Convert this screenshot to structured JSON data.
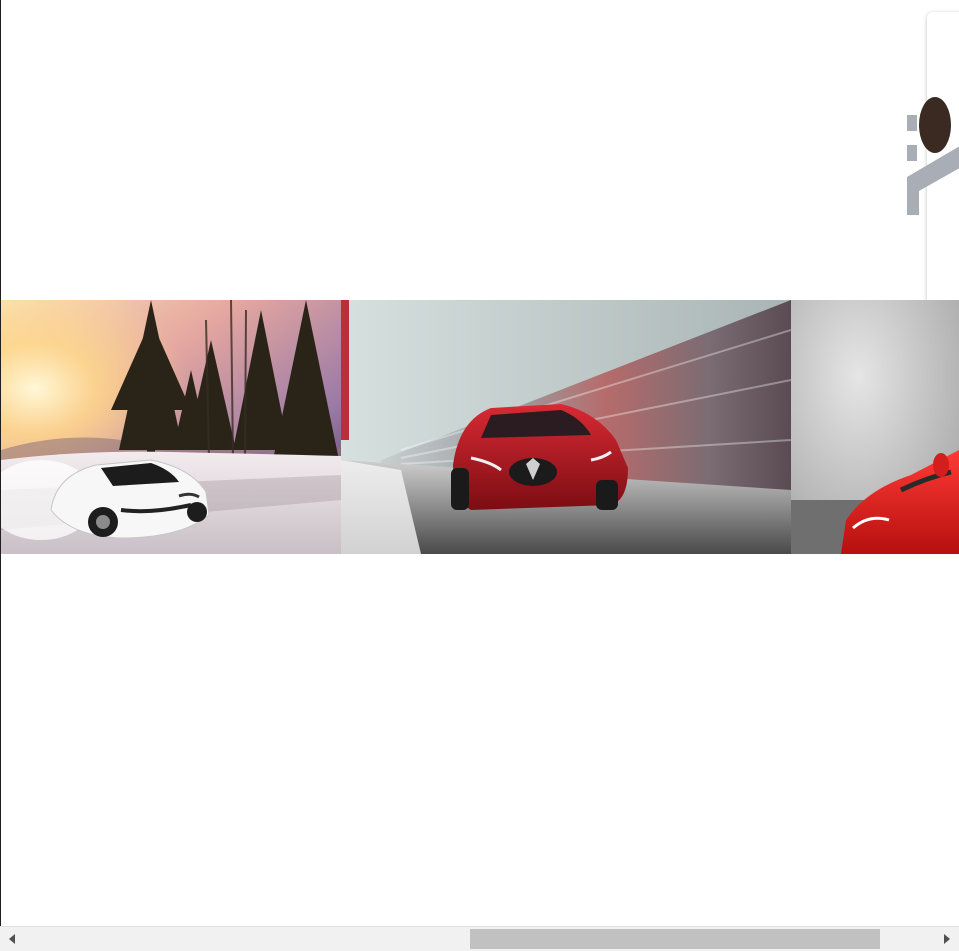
{
  "gallery": {
    "slides": [
      {
        "alt": "white-supercar-snow-image",
        "accent": "#f4f4f6"
      },
      {
        "alt": "red-sedan-motion-image",
        "accent": "#b3121c"
      },
      {
        "alt": "red-hypercar-image",
        "accent": "#e21b22"
      }
    ]
  },
  "scrollbar": {
    "orientation": "horizontal",
    "thumb_start_fraction": 0.49,
    "thumb_end_fraction": 0.94
  },
  "colors": {
    "background": "#ffffff",
    "card_shadow": "#bdbdbd",
    "logo_gray": "#a9adb5",
    "scrollbar_track": "#f1f1f1",
    "scrollbar_thumb": "#c1c1c1"
  }
}
